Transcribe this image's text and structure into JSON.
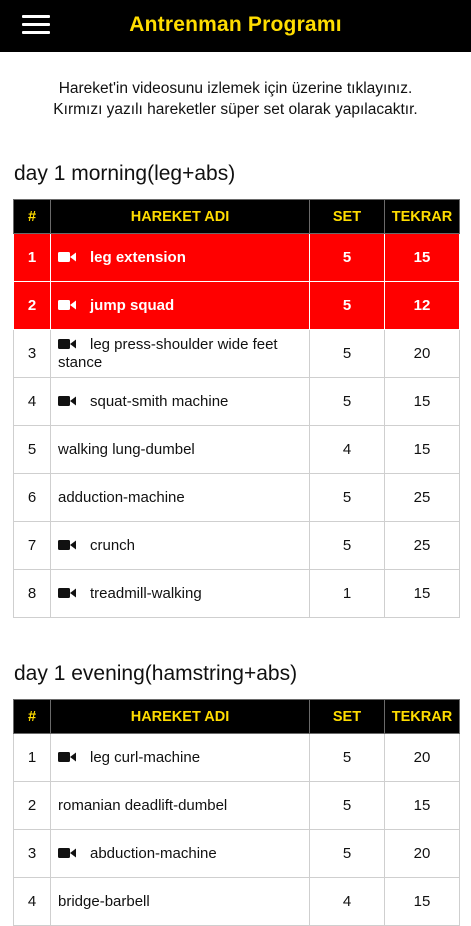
{
  "app": {
    "title": "Antrenman Programı"
  },
  "intro": {
    "line1": "Hareket'in videosunu izlemek için üzerine tıklayınız.",
    "line2": "Kırmızı yazılı hareketler süper set olarak yapılacaktır."
  },
  "columns": {
    "num": "#",
    "name": "HAREKET ADI",
    "set": "SET",
    "rep": "TEKRAR"
  },
  "colors": {
    "accent": "#ffdd00",
    "header_bg": "#000000",
    "superset": "#ff0000"
  },
  "sections": [
    {
      "title": "day 1 morning(leg+abs)",
      "rows": [
        {
          "num": "1",
          "name": "leg extension",
          "set": "5",
          "rep": "15",
          "video": true,
          "superset": true
        },
        {
          "num": "2",
          "name": "jump squad",
          "set": "5",
          "rep": "12",
          "video": true,
          "superset": true
        },
        {
          "num": "3",
          "name": "leg press-shoulder wide feet stance",
          "set": "5",
          "rep": "20",
          "video": true,
          "superset": false
        },
        {
          "num": "4",
          "name": "squat-smith machine",
          "set": "5",
          "rep": "15",
          "video": true,
          "superset": false
        },
        {
          "num": "5",
          "name": "walking lung-dumbel",
          "set": "4",
          "rep": "15",
          "video": false,
          "superset": false
        },
        {
          "num": "6",
          "name": "adduction-machine",
          "set": "5",
          "rep": "25",
          "video": false,
          "superset": false
        },
        {
          "num": "7",
          "name": "crunch",
          "set": "5",
          "rep": "25",
          "video": true,
          "superset": false
        },
        {
          "num": "8",
          "name": "treadmill-walking",
          "set": "1",
          "rep": "15",
          "video": true,
          "superset": false
        }
      ]
    },
    {
      "title": "day 1 evening(hamstring+abs)",
      "rows": [
        {
          "num": "1",
          "name": "leg curl-machine",
          "set": "5",
          "rep": "20",
          "video": true,
          "superset": false
        },
        {
          "num": "2",
          "name": "romanian deadlift-dumbel",
          "set": "5",
          "rep": "15",
          "video": false,
          "superset": false
        },
        {
          "num": "3",
          "name": "abduction-machine",
          "set": "5",
          "rep": "20",
          "video": true,
          "superset": false
        },
        {
          "num": "4",
          "name": "bridge-barbell",
          "set": "4",
          "rep": "15",
          "video": false,
          "superset": false
        }
      ]
    }
  ]
}
